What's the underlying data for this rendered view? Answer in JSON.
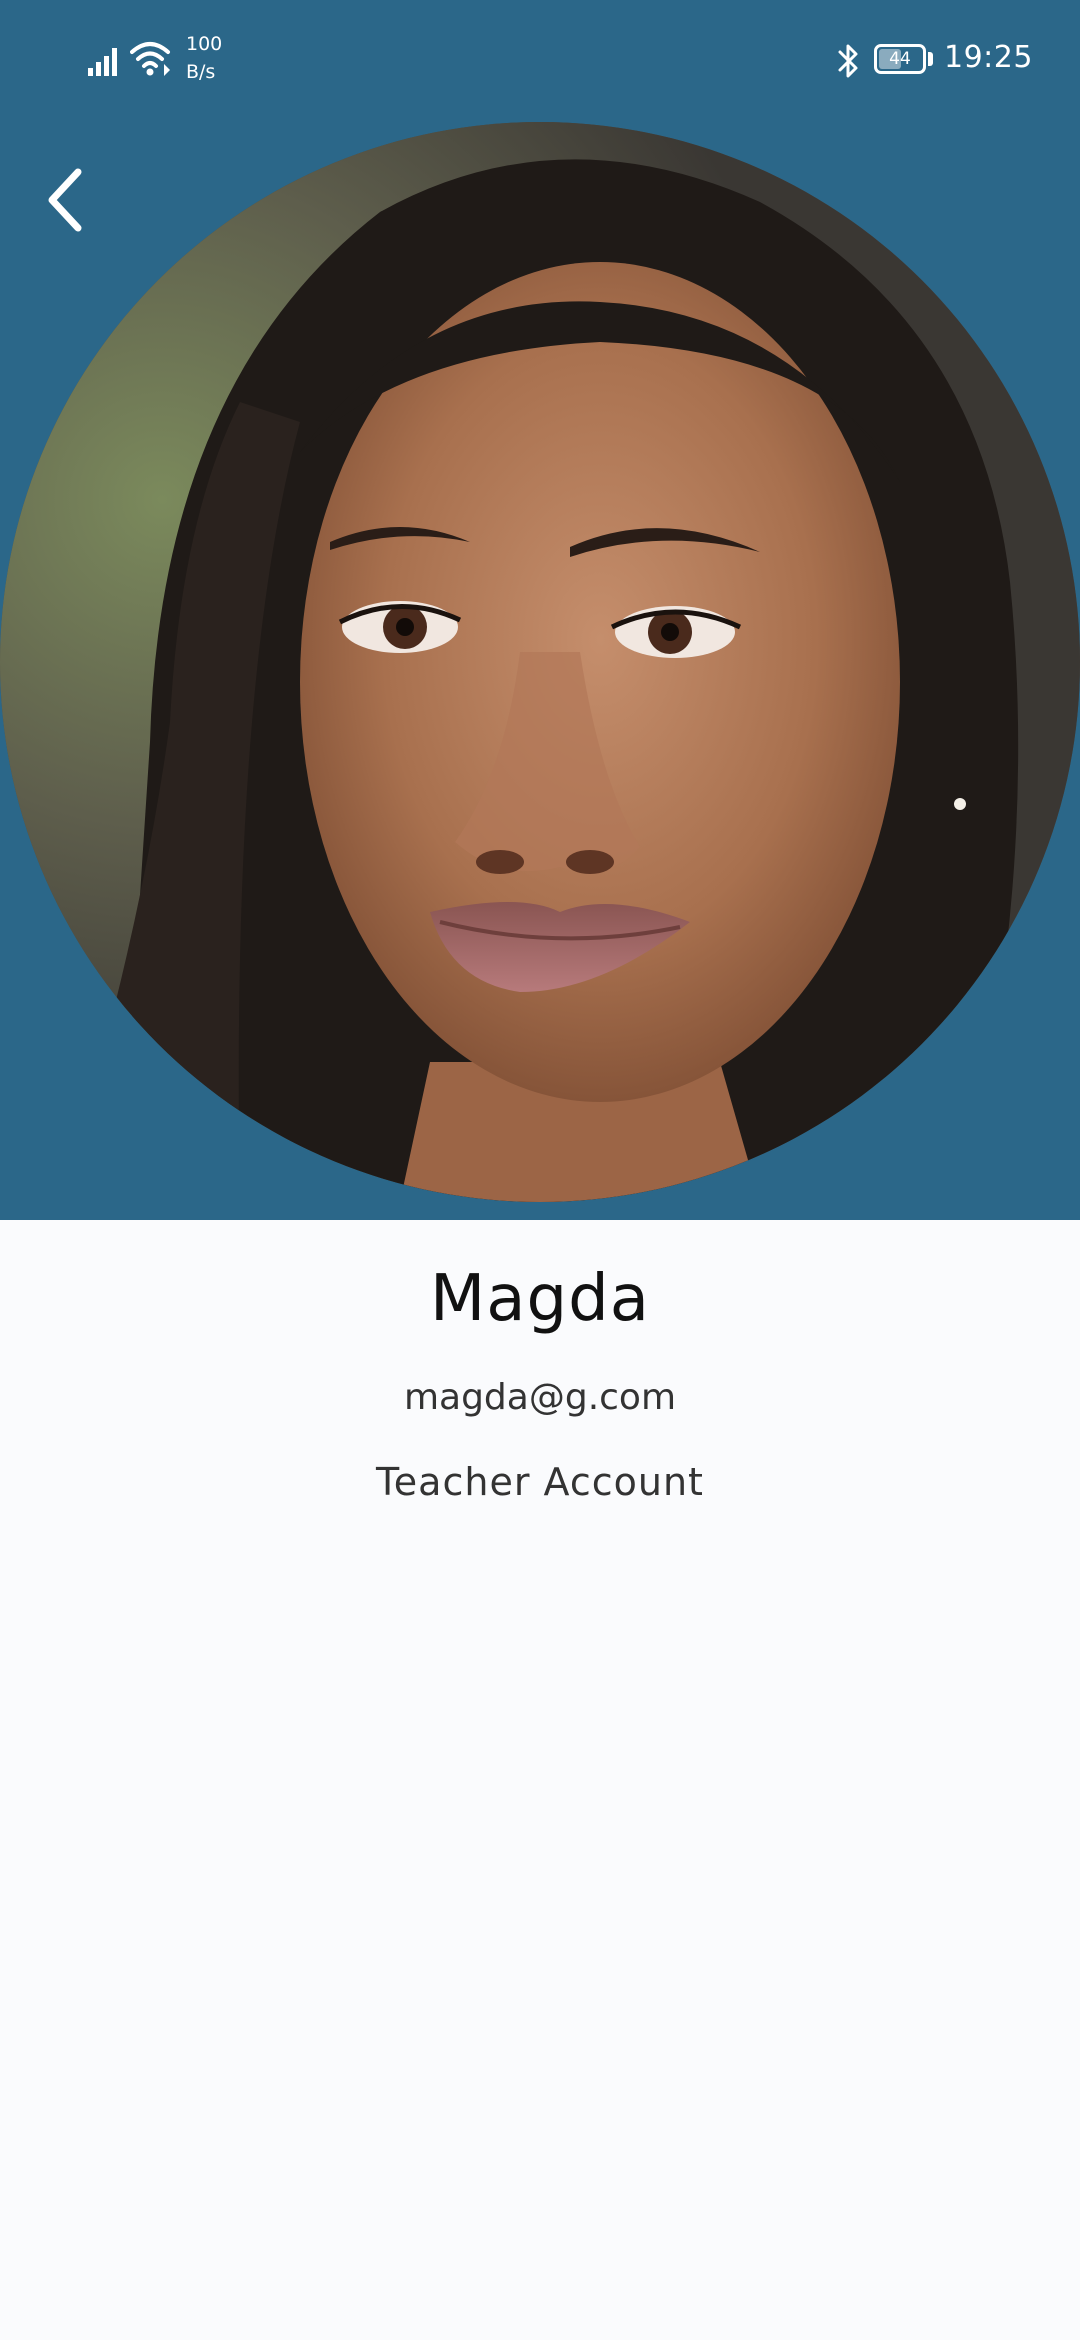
{
  "status_bar": {
    "network_speed_value": "100",
    "network_speed_unit": "B/s",
    "battery_level": "44",
    "time": "19:25",
    "icons": [
      "signal-icon",
      "wifi-icon",
      "bluetooth-icon",
      "battery-icon"
    ]
  },
  "header": {
    "background_color": "#2b6789",
    "back_icon": "back-arrow-icon"
  },
  "profile": {
    "name": "Magda",
    "email": "magda@g.com",
    "account_type": "Teacher Account"
  },
  "colors": {
    "page_background": "#fafbfd",
    "header_background": "#2b6789",
    "text_primary": "#111111",
    "text_secondary": "#333333"
  }
}
